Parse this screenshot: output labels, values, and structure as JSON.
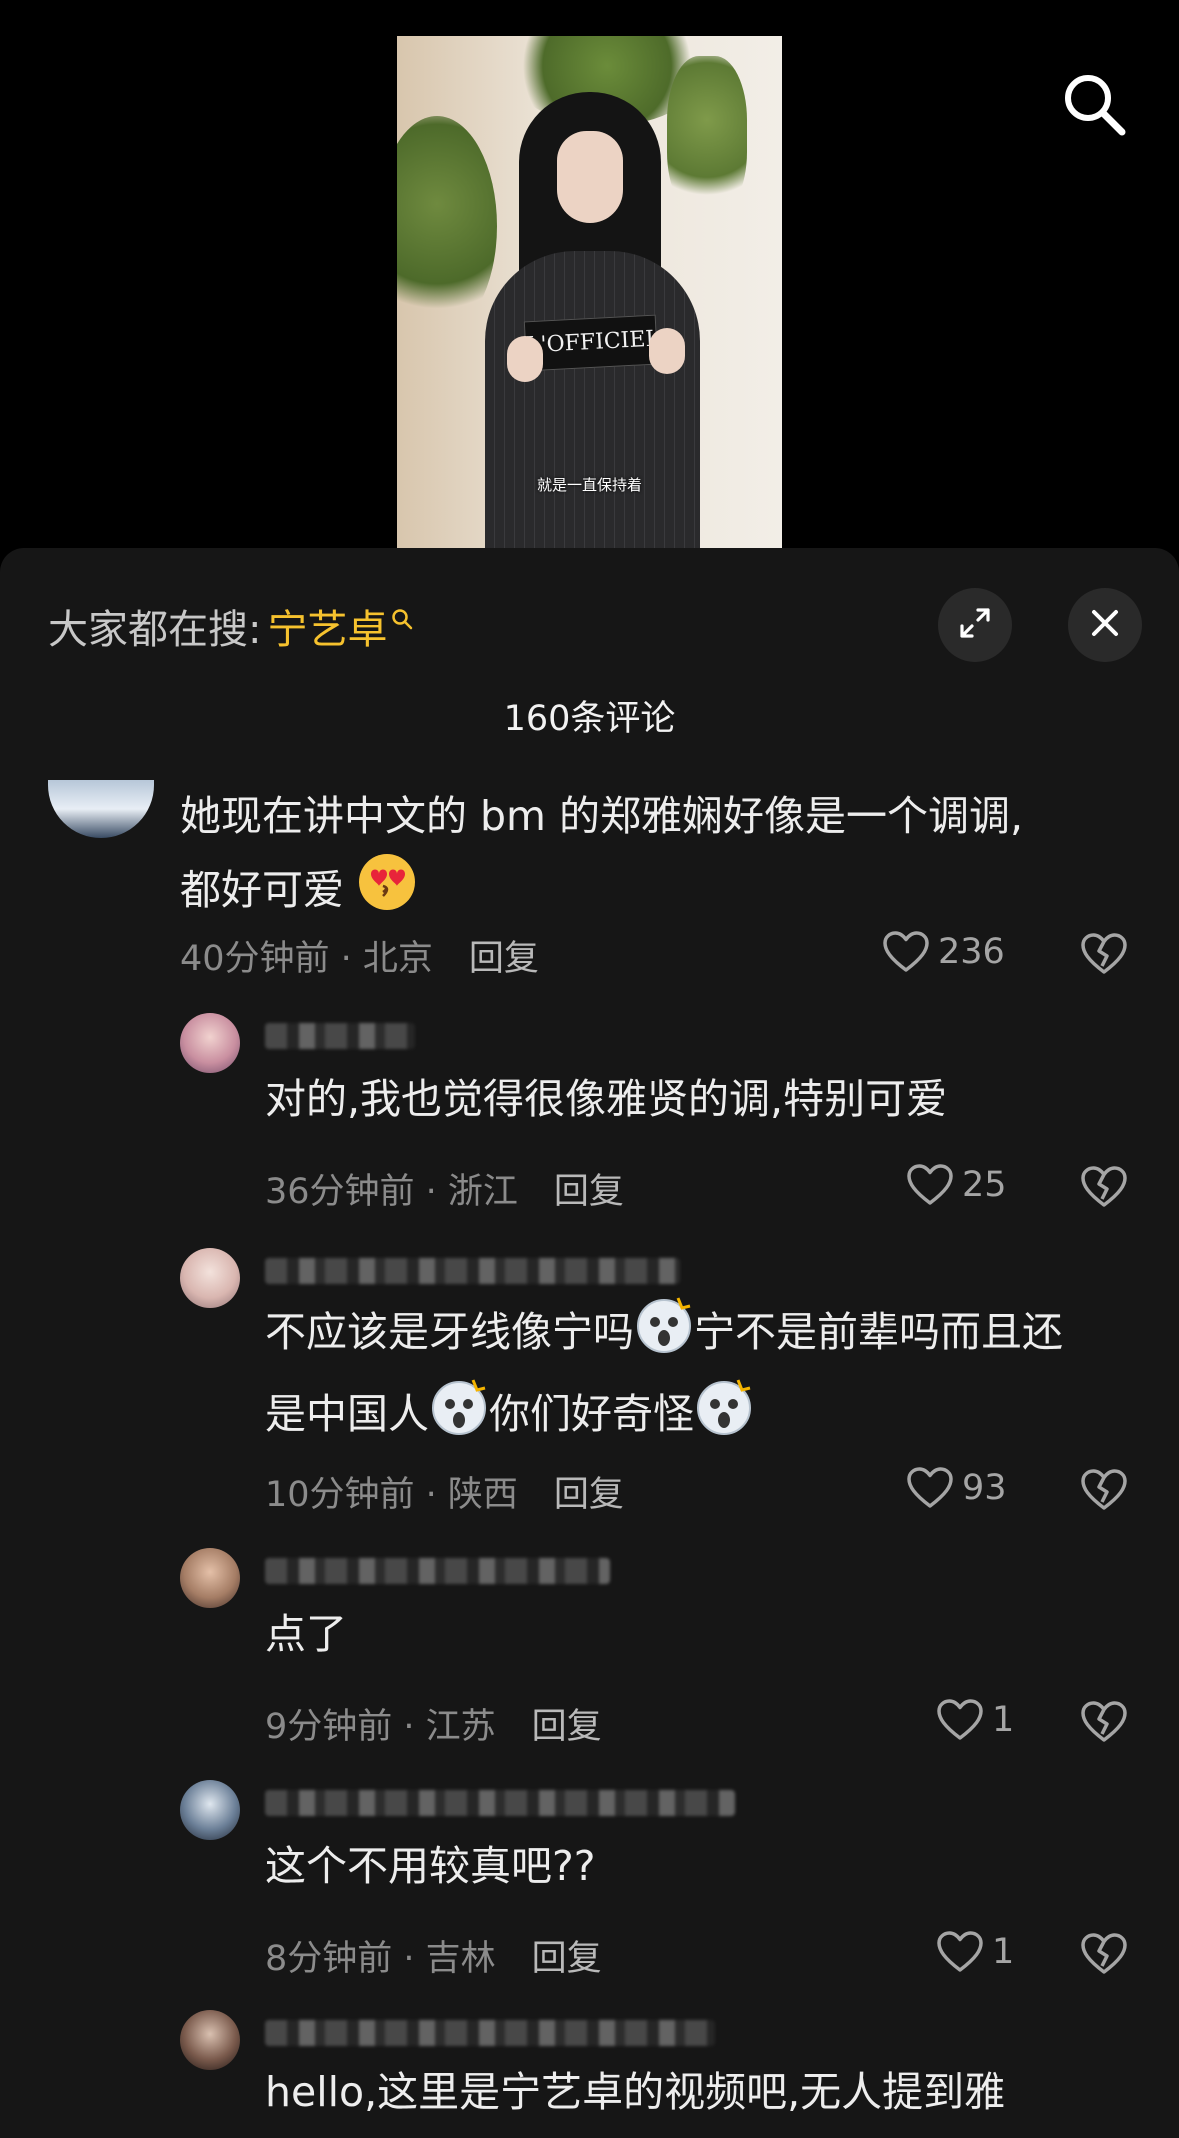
{
  "video": {
    "subtitle": "就是一直保持着",
    "card_text": "L'OFFICIEL"
  },
  "panel": {
    "hot_label": "大家都在搜:",
    "hot_term": "宁艺卓",
    "comment_count": "160条评论"
  },
  "comments": [
    {
      "text_line1": "她现在讲中文的 bm 的郑雅娴好像是一个调调,",
      "text_line2": "都好可爱",
      "time_location": "40分钟前 · 北京",
      "reply_label": "回复",
      "likes": "236"
    },
    {
      "text_line1": "对的,我也觉得很像雅贤的调,特别可爱",
      "time_location": "36分钟前 · 浙江",
      "reply_label": "回复",
      "likes": "25"
    },
    {
      "text_line1": "不应该是牙线像宁吗",
      "text_line1b": "宁不是前辈吗而且还",
      "text_line2a": "是中国人",
      "text_line2b": "你们好奇怪",
      "time_location": "10分钟前 · 陕西",
      "reply_label": "回复",
      "likes": "93"
    },
    {
      "text_line1": "点了",
      "time_location": "9分钟前 · 江苏",
      "reply_label": "回复",
      "likes": "1"
    },
    {
      "text_line1": "这个不用较真吧??",
      "time_location": "8分钟前 · 吉林",
      "reply_label": "回复",
      "likes": "1"
    },
    {
      "text_line1": "hello,这里是宁艺卓的视频吧,无人提到雅"
    }
  ],
  "icons": {
    "search": "search-icon",
    "expand": "expand-icon",
    "close": "close-icon",
    "like": "heart-icon",
    "dislike": "broken-heart-icon",
    "emoji_kiss": "heart-eyes-kiss-emoji",
    "emoji_shock": "shocked-face-emoji"
  },
  "colors": {
    "accent": "#f6c22e",
    "panel_bg": "#161616",
    "text": "#ededed",
    "meta": "#8b8b8b"
  }
}
